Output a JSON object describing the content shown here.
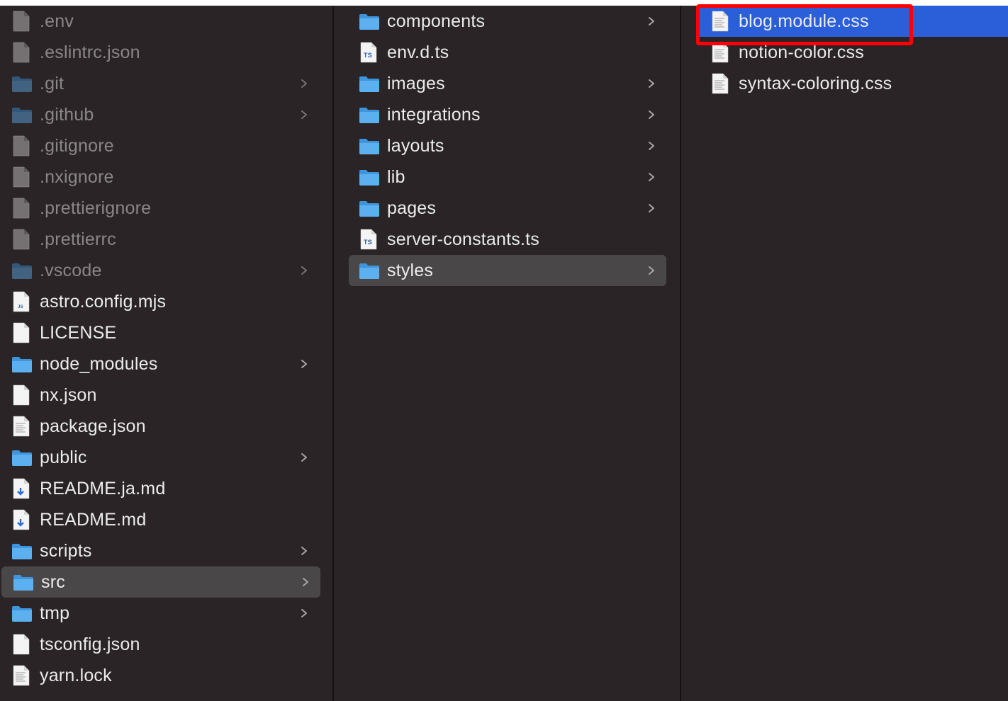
{
  "column1": {
    "items": [
      {
        "label": ".env",
        "type": "file",
        "dim": true
      },
      {
        "label": ".eslintrc.json",
        "type": "file",
        "dim": true
      },
      {
        "label": ".git",
        "type": "folder",
        "dim": true
      },
      {
        "label": ".github",
        "type": "folder",
        "dim": true
      },
      {
        "label": ".gitignore",
        "type": "file",
        "dim": true
      },
      {
        "label": ".nxignore",
        "type": "file",
        "dim": true
      },
      {
        "label": ".prettierignore",
        "type": "file",
        "dim": true
      },
      {
        "label": ".prettierrc",
        "type": "file",
        "dim": true
      },
      {
        "label": ".vscode",
        "type": "folder",
        "dim": true
      },
      {
        "label": "astro.config.mjs",
        "type": "js"
      },
      {
        "label": "LICENSE",
        "type": "file"
      },
      {
        "label": "node_modules",
        "type": "folder"
      },
      {
        "label": "nx.json",
        "type": "file"
      },
      {
        "label": "package.json",
        "type": "json"
      },
      {
        "label": "public",
        "type": "folder"
      },
      {
        "label": "README.ja.md",
        "type": "md"
      },
      {
        "label": "README.md",
        "type": "md"
      },
      {
        "label": "scripts",
        "type": "folder"
      },
      {
        "label": "src",
        "type": "folder",
        "selected": true
      },
      {
        "label": "tmp",
        "type": "folder"
      },
      {
        "label": "tsconfig.json",
        "type": "file"
      },
      {
        "label": "yarn.lock",
        "type": "text"
      }
    ]
  },
  "column2": {
    "items": [
      {
        "label": "components",
        "type": "folder"
      },
      {
        "label": "env.d.ts",
        "type": "ts"
      },
      {
        "label": "images",
        "type": "folder"
      },
      {
        "label": "integrations",
        "type": "folder"
      },
      {
        "label": "layouts",
        "type": "folder"
      },
      {
        "label": "lib",
        "type": "folder"
      },
      {
        "label": "pages",
        "type": "folder"
      },
      {
        "label": "server-constants.ts",
        "type": "ts"
      },
      {
        "label": "styles",
        "type": "folder",
        "selected": true
      }
    ]
  },
  "column3": {
    "items": [
      {
        "label": "blog.module.css",
        "type": "css",
        "highlighted": true
      },
      {
        "label": "notion-color.css",
        "type": "css"
      },
      {
        "label": "syntax-coloring.css",
        "type": "css"
      }
    ]
  },
  "icon_labels": {
    "ts": "TS",
    "js": "JS"
  },
  "colors": {
    "background": "#2a2426",
    "selection_gray": "#4a4748",
    "selection_blue": "#2b5fd9",
    "annotation_red": "#ff0000",
    "folder_blue": "#5db0f0"
  }
}
